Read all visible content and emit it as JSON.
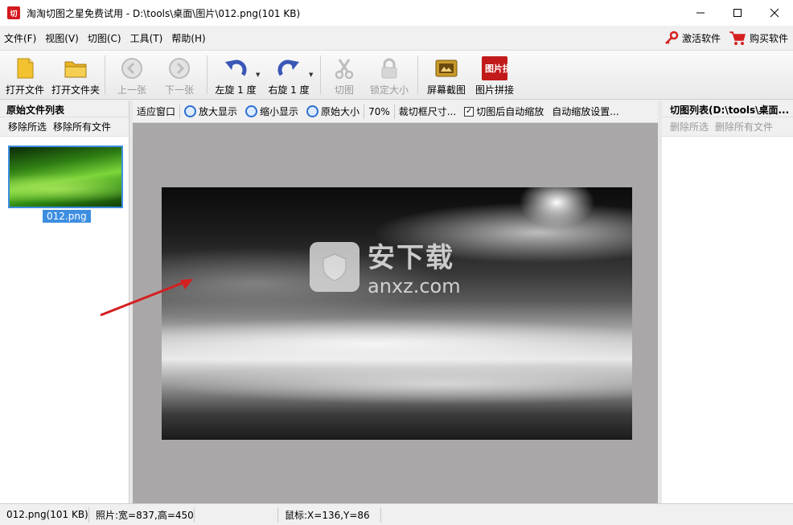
{
  "window": {
    "title": "淘淘切图之星免费试用 - D:\\tools\\桌面\\图片\\012.png(101 KB)",
    "app_icon": "切"
  },
  "menu": {
    "items": [
      "文件(F)",
      "视图(V)",
      "切图(C)",
      "工具(T)",
      "帮助(H)"
    ],
    "activate": "激活软件",
    "buy": "购买软件"
  },
  "toolbar": {
    "open_file": "打开文件",
    "open_folder": "打开文件夹",
    "prev": "上一张",
    "next": "下一张",
    "rotate_left": "左旋 1 度",
    "rotate_right": "右旋 1 度",
    "cut": "切图",
    "lock_size": "锁定大小",
    "screenshot": "屏幕截图",
    "stitch": "图片拼接",
    "stitch_icon_text": "图片拼接"
  },
  "left_panel": {
    "title": "原始文件列表",
    "remove_selected": "移除所选",
    "remove_all": "移除所有文件",
    "file_name": "012.png"
  },
  "center_toolbar": {
    "fit_window": "适应窗口",
    "zoom_in": "放大显示",
    "zoom_out": "缩小显示",
    "original_size": "原始大小",
    "zoom_level": "70%",
    "crop_size": "裁切框尺寸...",
    "auto_zoom_after_cut": "切图后自动缩放",
    "auto_zoom_settings": "自动缩放设置..."
  },
  "watermark": {
    "cn": "安下载",
    "en": "anxz.com"
  },
  "right_panel": {
    "title": "切图列表(D:\\tools\\桌面...",
    "delete_selected": "删除所选",
    "delete_all": "删除所有文件"
  },
  "status": {
    "file": "012.png(101 KB)",
    "photo_size": "照片:宽=837,高=450",
    "mouse": "鼠标:X=136,Y=86"
  },
  "colors": {
    "accent": "#3d8ee0",
    "canvas_bg": "#a9a7a8",
    "arrow": "#d42020"
  }
}
